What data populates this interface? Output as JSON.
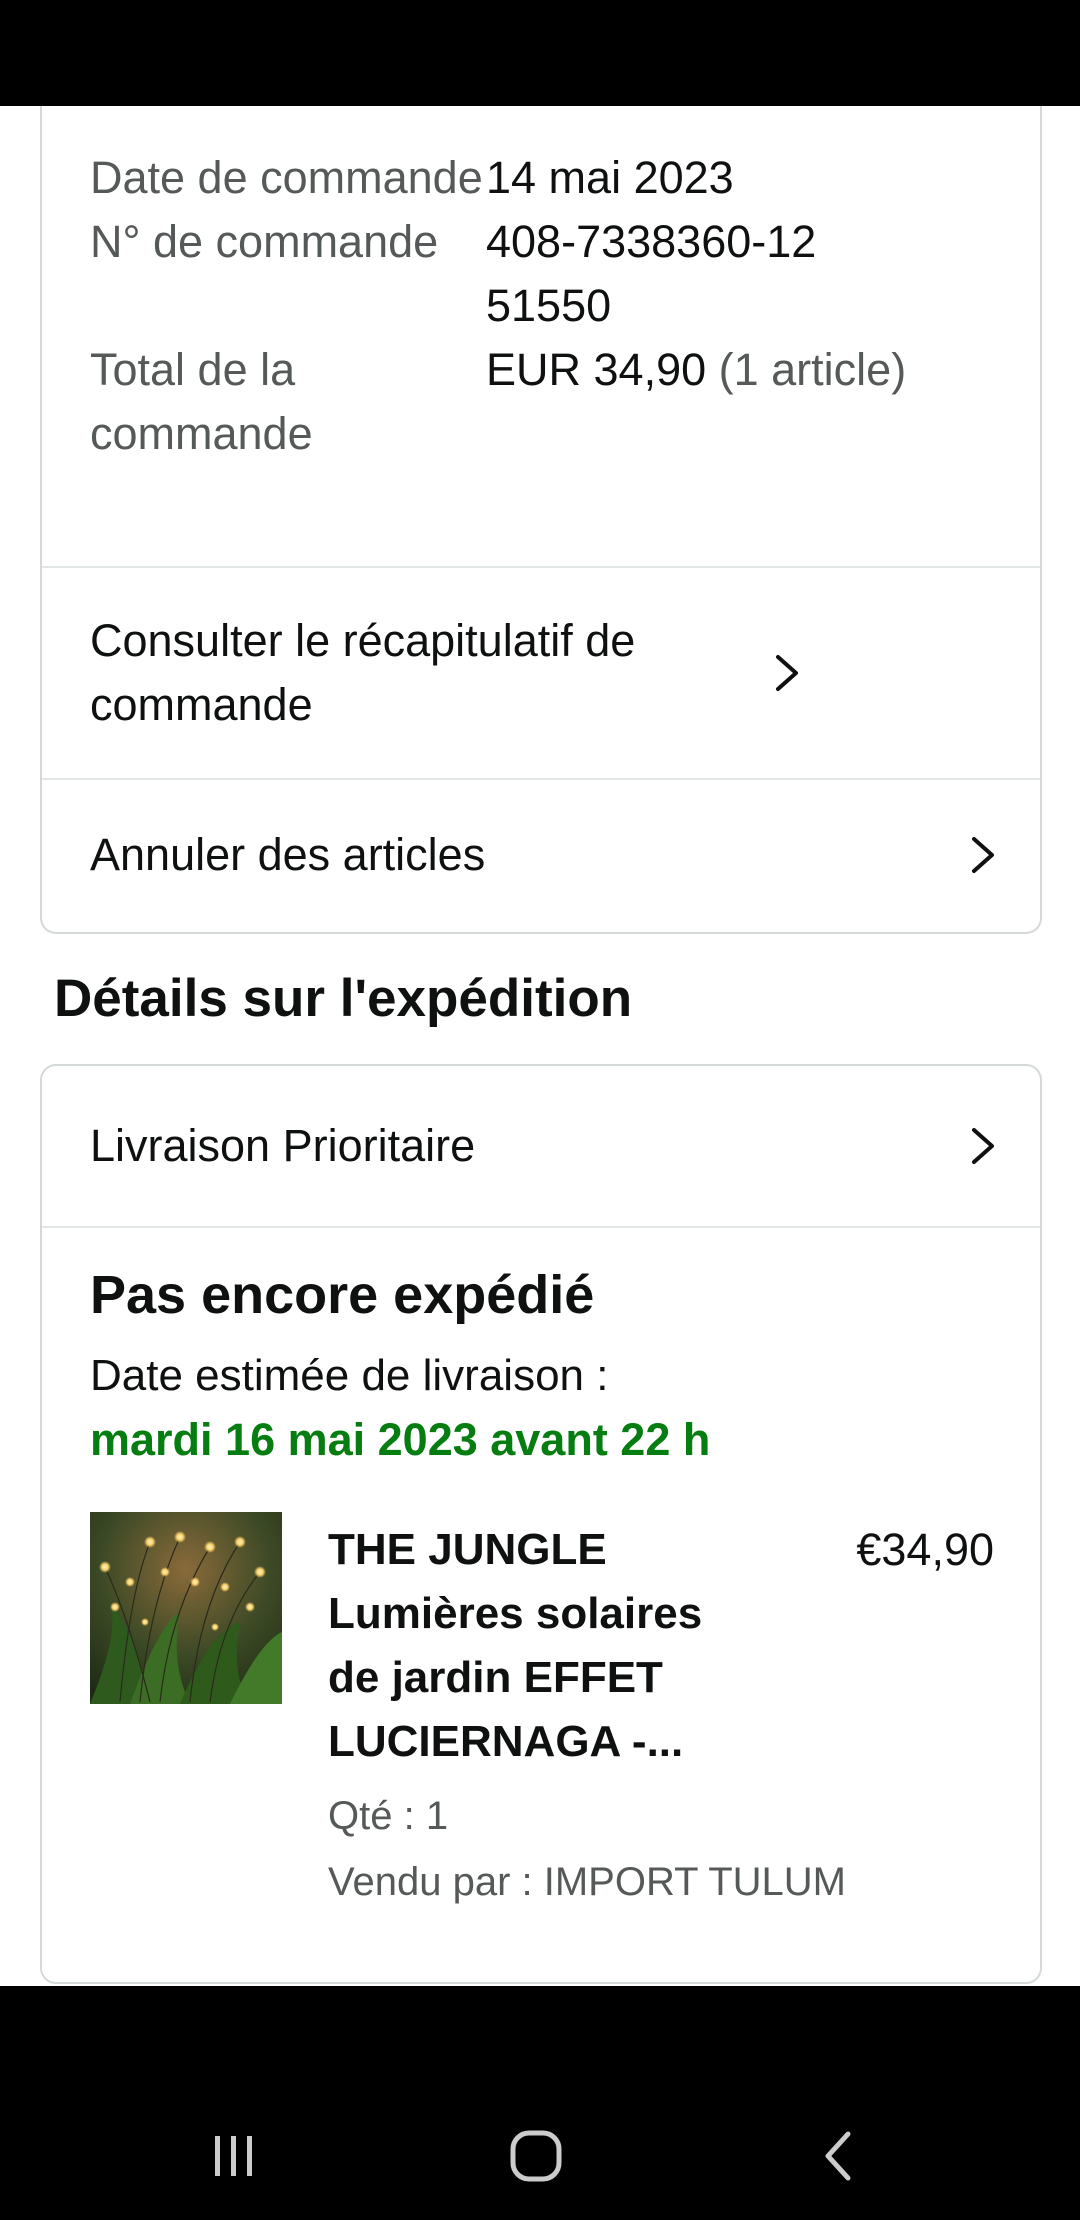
{
  "order": {
    "date_label": "Date de commande",
    "date_value": "14 mai 2023",
    "number_label": "N° de commande",
    "number_value": "408-7338360-1251550",
    "total_label": "Total de la commande",
    "total_value": "EUR 34,90",
    "total_items": "(1 article)",
    "summary_link": "Consulter le récapitulatif de commande",
    "cancel_link": "Annuler des articles"
  },
  "shipping": {
    "section_title": "Détails sur l'expédition",
    "method": "Livraison Prioritaire",
    "status": "Pas encore expédié",
    "eta_label": "Date estimée de livraison :",
    "eta_date": "mardi 16 mai 2023 avant 22 h",
    "eta_color": "#067d10"
  },
  "product": {
    "title": "THE JUNGLE Lumières solaires de jardin EFFET LUCIERNAGA -...",
    "price": "€34,90",
    "qty": "Qté : 1",
    "seller": "Vendu par : IMPORT TULUM",
    "image_icon": "solar-garden-lights-photo"
  },
  "navigation": {
    "recent_icon": "recent-apps-icon",
    "home_icon": "home-icon",
    "back_icon": "back-icon"
  }
}
